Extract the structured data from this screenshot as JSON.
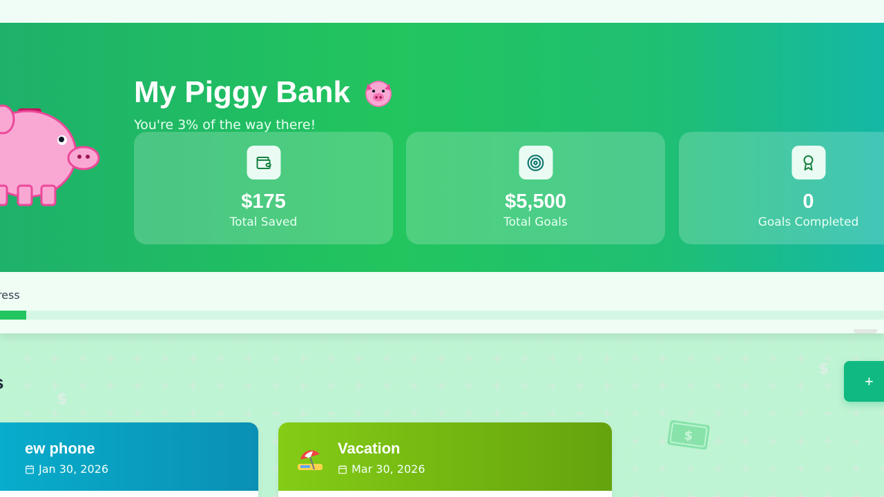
{
  "hero": {
    "title": "My Piggy Bank",
    "subtitle": "You're 3% of the way there!",
    "progress_fraction": 0.03,
    "stats": [
      {
        "value": "$175",
        "label": "Total Saved",
        "icon": "wallet-icon"
      },
      {
        "value": "$5,500",
        "label": "Total Goals",
        "icon": "target-icon"
      },
      {
        "value": "0",
        "label": "Goals Completed",
        "icon": "award-icon"
      }
    ]
  },
  "progress": {
    "label": "ogress"
  },
  "goals": {
    "heading": "als",
    "add_button_label": "+",
    "items": [
      {
        "name": "ew phone",
        "date": "Jan 30, 2026",
        "icon": "phone-icon"
      },
      {
        "name": "Vacation",
        "date": "Mar 30, 2026",
        "icon": "beach-umbrella-icon"
      }
    ]
  },
  "colors": {
    "hero_start": "#1eb16a",
    "hero_end": "#14b8a6",
    "accent": "#10b981",
    "phone_card": "#08b0cf",
    "vacation_card": "#84cc16"
  }
}
